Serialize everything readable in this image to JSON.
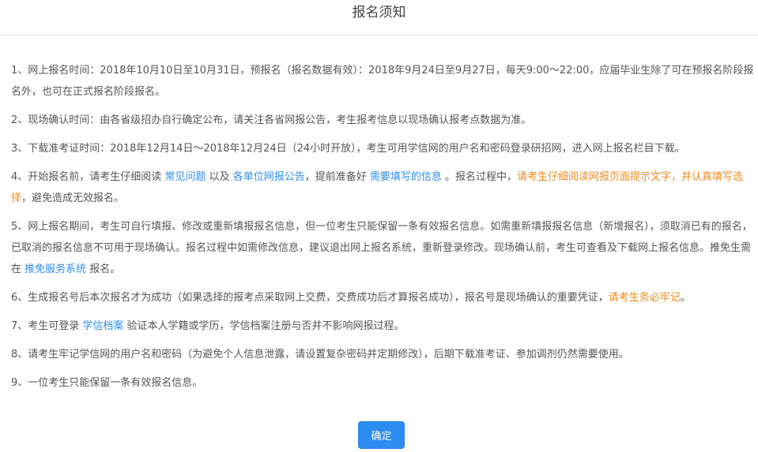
{
  "header": {
    "title": "报名须知"
  },
  "notices": [
    {
      "text": "1、网上报名时间：2018年10月10日至10月31日，预报名（报名数据有效）：2018年9月24日至9月27日，每天9:00～22:00，应届毕业生除了可在预报名阶段报名外，也可在正式报名阶段报名。"
    },
    {
      "text": "2、现场确认时间：由各省级招办自行确定公布，请关注各省网报公告，考生报考信息以现场确认报考点数据为准。"
    },
    {
      "text": "3、下载准考证时间：2018年12月14日～2018年12月24日（24小时开放），考生可用学信网的用户名和密码登录研招网，进入网上报名栏目下载。"
    },
    {
      "t1": "4、开始报名前，请考生仔细阅读 ",
      "link1": "常见问题",
      "t2": " 以及 ",
      "link2": "各单位网报公告",
      "t3": "，提前准备好 ",
      "link3": "需要填写的信息",
      "t4": " 。报名过程中，",
      "warn": "请考生仔细阅读网报页面提示文字，并认真填写选择",
      "t5": "，避免造成无效报名。"
    },
    {
      "t1": "5、网上报名期间，考生可自行填报、修改或重新填报报名信息，但一位考生只能保留一条有效报名信息。如需重新填报报名信息（新增报名），须取消已有的报名，已取消的报名信息不可用于现场确认。报名过程中如需修改信息，建议退出网上报名系统，重新登录修改。现场确认前，考生可查看及下载网上报名信息。推免生需在 ",
      "link1": "推免服务系统",
      "t2": " 报名。"
    },
    {
      "t1": "6、生成报名号后本次报名才为成功（如果选择的报考点采取网上交费，交费成功后才算报名成功），报名号是现场确认的重要凭证，",
      "warn": "请考生务必牢记",
      "t2": "。"
    },
    {
      "t1": "7、考生可登录 ",
      "link1": "学信档案",
      "t2": " 验证本人学籍或学历，学信档案注册与否并不影响网报过程。"
    },
    {
      "text": "8、请考生牢记学信网的用户名和密码（为避免个人信息泄露，请设置复杂密码并定期修改），后期下载准考证、参加调剂仍然需要使用。"
    },
    {
      "text": "9、一位考生只能保留一条有效报名信息。"
    }
  ],
  "confirm_button": {
    "label": "确定"
  },
  "colors": {
    "link": "#2e8ded",
    "warning": "#f08a1c",
    "button": "#2d8cf0",
    "text": "#555555"
  }
}
